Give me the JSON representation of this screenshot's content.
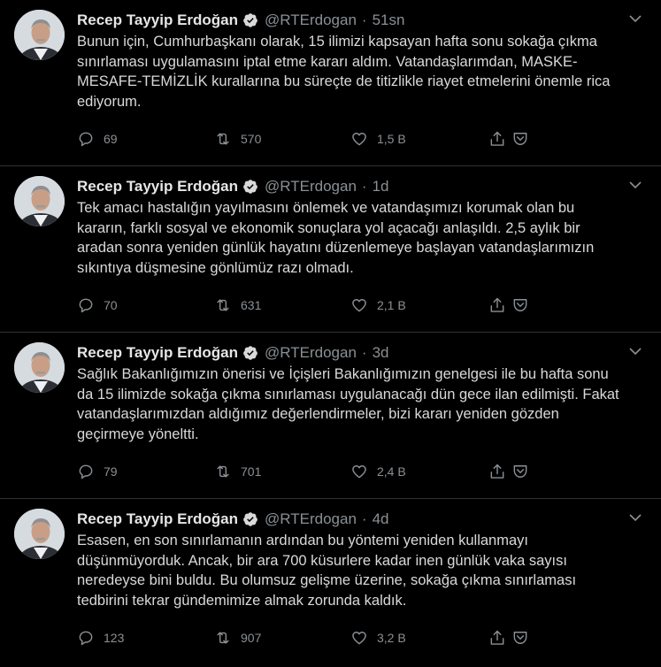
{
  "colors": {
    "background": "#000000",
    "text": "#d9d9d9",
    "muted": "#8a9095",
    "verified": "#d9d9d9",
    "divider": "#2f3336"
  },
  "tweets": [
    {
      "author": "Recep Tayyip Erdoğan",
      "handle": "@RTErdogan",
      "time": "51sn",
      "lines": [
        "Bunun için, Cumhurbaşkanı olarak, 15 ilimizi kapsayan hafta sonu sokağa çıkma",
        "sınırlaması uygulamasını iptal etme kararı aldım. Vatandaşlarımdan, MASKE-",
        "MESAFE-TEMİZLİK kurallarına bu süreçte de titizlikle riayet etmelerini önemle rica",
        "ediyorum."
      ],
      "replies": "69",
      "retweets": "570",
      "likes": "1,5 B"
    },
    {
      "author": "Recep Tayyip Erdoğan",
      "handle": "@RTErdogan",
      "time": "1d",
      "lines": [
        "Tek amacı hastalığın yayılmasını önlemek ve vatandaşımızı korumak olan bu",
        "kararın, farklı sosyal ve ekonomik sonuçlara yol açacağı anlaşıldı. 2,5 aylık bir",
        "aradan sonra yeniden günlük hayatını düzenlemeye başlayan vatandaşlarımızın",
        "sıkıntıya düşmesine gönlümüz razı olmadı."
      ],
      "replies": "70",
      "retweets": "631",
      "likes": "2,1 B"
    },
    {
      "author": "Recep Tayyip Erdoğan",
      "handle": "@RTErdogan",
      "time": "3d",
      "lines": [
        "Sağlık Bakanlığımızın önerisi ve İçişleri Bakanlığımızın genelgesi ile bu hafta sonu",
        "da 15 ilimizde sokağa çıkma sınırlaması uygulanacağı dün gece ilan edilmişti. Fakat",
        "vatandaşlarımızdan aldığımız değerlendirmeler, bizi kararı yeniden gözden",
        "geçirmeye yöneltti."
      ],
      "replies": "79",
      "retweets": "701",
      "likes": "2,4 B"
    },
    {
      "author": "Recep Tayyip Erdoğan",
      "handle": "@RTErdogan",
      "time": "4d",
      "lines": [
        "Esasen, en son sınırlamanın ardından bu yöntemi yeniden kullanmayı",
        "düşünmüyorduk. Ancak, bir ara 700 küsurlere kadar inen günlük vaka sayısı",
        "neredeyse bini buldu. Bu olumsuz gelişme üzerine, sokağa çıkma sınırlaması",
        "tedbirini tekrar gündemimize almak zorunda kaldık."
      ],
      "replies": "123",
      "retweets": "907",
      "likes": "3,2 B"
    }
  ]
}
